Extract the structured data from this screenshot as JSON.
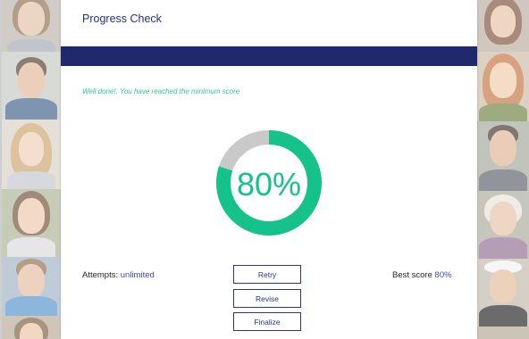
{
  "header": {
    "title": "Progress Check",
    "banner_color": "#1f2a6c"
  },
  "message": "Well done!. You have reached the minimum score",
  "score": {
    "percent_label": "80%",
    "fraction": 0.8,
    "fill_color": "#14c28a",
    "track_color": "#c9c9c9"
  },
  "attempts": {
    "label": "Attempts:",
    "value": "unlimited"
  },
  "best_score": {
    "label": "Best score",
    "value": "80%"
  },
  "buttons": {
    "retry": "Retry",
    "revise": "Revise",
    "finalize": "Finalize"
  }
}
